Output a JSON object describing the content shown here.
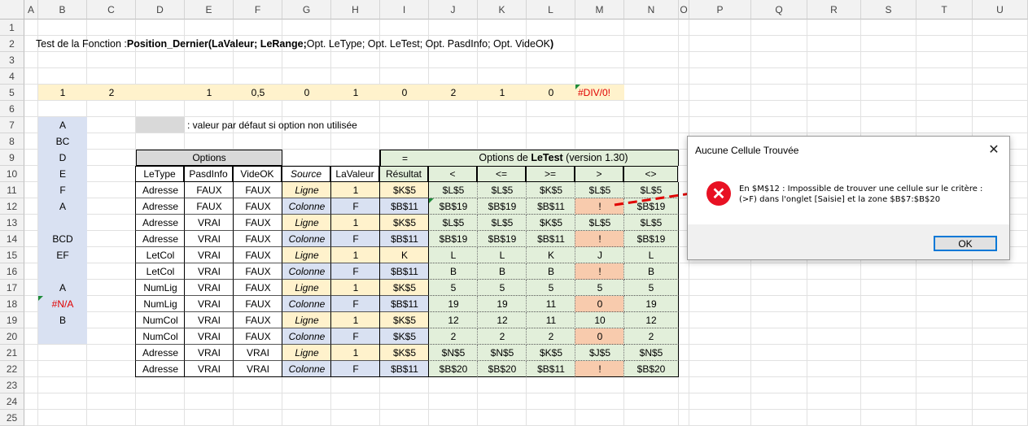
{
  "col_labels": [
    "A",
    "B",
    "C",
    "D",
    "E",
    "F",
    "G",
    "H",
    "I",
    "J",
    "K",
    "L",
    "M",
    "N",
    "O",
    "P",
    "Q",
    "R",
    "S",
    "T",
    "U"
  ],
  "row_labels": [
    "1",
    "2",
    "3",
    "4",
    "5",
    "6",
    "7",
    "8",
    "9",
    "10",
    "11",
    "12",
    "13",
    "14",
    "15",
    "16",
    "17",
    "18",
    "19",
    "20",
    "21",
    "22",
    "23",
    "24",
    "25"
  ],
  "colors": {
    "yellow_band": "#fff2cc",
    "blue_list": "#d9e1f2",
    "gray_legend": "#d9d9d9",
    "options_header": "#d9d9d9",
    "green_block": "#e2efda",
    "yellow_source": "#fff2cc",
    "blue_source": "#d9e1f2",
    "orange_error": "#f8cbad",
    "error_red": "#e00000",
    "arrow_red": "#e00000"
  },
  "title": {
    "prefix": "Test de la Fonction : ",
    "func": "Position_Dernier(LaValeur; LeRange;",
    "rest": " Opt. LeType; Opt. LeTest; Opt. PasdInfo; Opt. VideOK",
    "close": ")"
  },
  "row5": [
    "1",
    "2",
    "",
    "1",
    "0,5",
    "0",
    "1",
    "0",
    "2",
    "1",
    "0",
    "#DIV/0!"
  ],
  "list_b": [
    "A",
    "BC",
    "D",
    "E",
    "F",
    "A",
    "",
    "BCD",
    "EF",
    "",
    "A",
    "#N/A",
    "B",
    ""
  ],
  "legend_text": ": valeur par défaut si option non utilisée",
  "table": {
    "options_label": "Options",
    "eq_label": "=",
    "letest_prefix": "Options de ",
    "letest_bold": "LeTest",
    "letest_suffix": " (version 1.30)",
    "headers": [
      "LeType",
      "PasdInfo",
      "VideOK",
      "Source",
      "LaValeur",
      "Résultat",
      "<",
      "<=",
      ">=",
      ">",
      "<>"
    ],
    "rows": [
      [
        "Adresse",
        "FAUX",
        "FAUX",
        "Ligne",
        "1",
        "$K$5",
        "$L$5",
        "$L$5",
        "$K$5",
        "$L$5",
        "$L$5"
      ],
      [
        "Adresse",
        "FAUX",
        "FAUX",
        "Colonne",
        "F",
        "$B$11",
        "$B$19",
        "$B$19",
        "$B$11",
        "!",
        "$B$19"
      ],
      [
        "Adresse",
        "VRAI",
        "FAUX",
        "Ligne",
        "1",
        "$K$5",
        "$L$5",
        "$L$5",
        "$K$5",
        "$L$5",
        "$L$5"
      ],
      [
        "Adresse",
        "VRAI",
        "FAUX",
        "Colonne",
        "F",
        "$B$11",
        "$B$19",
        "$B$19",
        "$B$11",
        "!",
        "$B$19"
      ],
      [
        "LetCol",
        "VRAI",
        "FAUX",
        "Ligne",
        "1",
        "K",
        "L",
        "L",
        "K",
        "J",
        "L"
      ],
      [
        "LetCol",
        "VRAI",
        "FAUX",
        "Colonne",
        "F",
        "$B$11",
        "B",
        "B",
        "B",
        "!",
        "B"
      ],
      [
        "NumLig",
        "VRAI",
        "FAUX",
        "Ligne",
        "1",
        "$K$5",
        "5",
        "5",
        "5",
        "5",
        "5"
      ],
      [
        "NumLig",
        "VRAI",
        "FAUX",
        "Colonne",
        "F",
        "$B$11",
        "19",
        "19",
        "11",
        "0",
        "19"
      ],
      [
        "NumCol",
        "VRAI",
        "FAUX",
        "Ligne",
        "1",
        "$K$5",
        "12",
        "12",
        "11",
        "10",
        "12"
      ],
      [
        "NumCol",
        "VRAI",
        "FAUX",
        "Colonne",
        "F",
        "$K$5",
        "2",
        "2",
        "2",
        "0",
        "2"
      ],
      [
        "Adresse",
        "VRAI",
        "VRAI",
        "Ligne",
        "1",
        "$K$5",
        "$N$5",
        "$N$5",
        "$K$5",
        "$J$5",
        "$N$5"
      ],
      [
        "Adresse",
        "VRAI",
        "VRAI",
        "Colonne",
        "F",
        "$B$11",
        "$B$20",
        "$B$20",
        "$B$11",
        "!",
        "$B$20"
      ]
    ]
  },
  "dialog": {
    "title": "Aucune Cellule Trouvée",
    "close_glyph": "✕",
    "icon": "error-icon",
    "icon_glyph": "✕",
    "message_line1": "En $M$12 : Impossible de trouver une cellule sur le critère :",
    "message_line2": "(>F) dans l'onglet [Saisie] et la zone $B$7:$B$20",
    "ok_label": "OK"
  }
}
